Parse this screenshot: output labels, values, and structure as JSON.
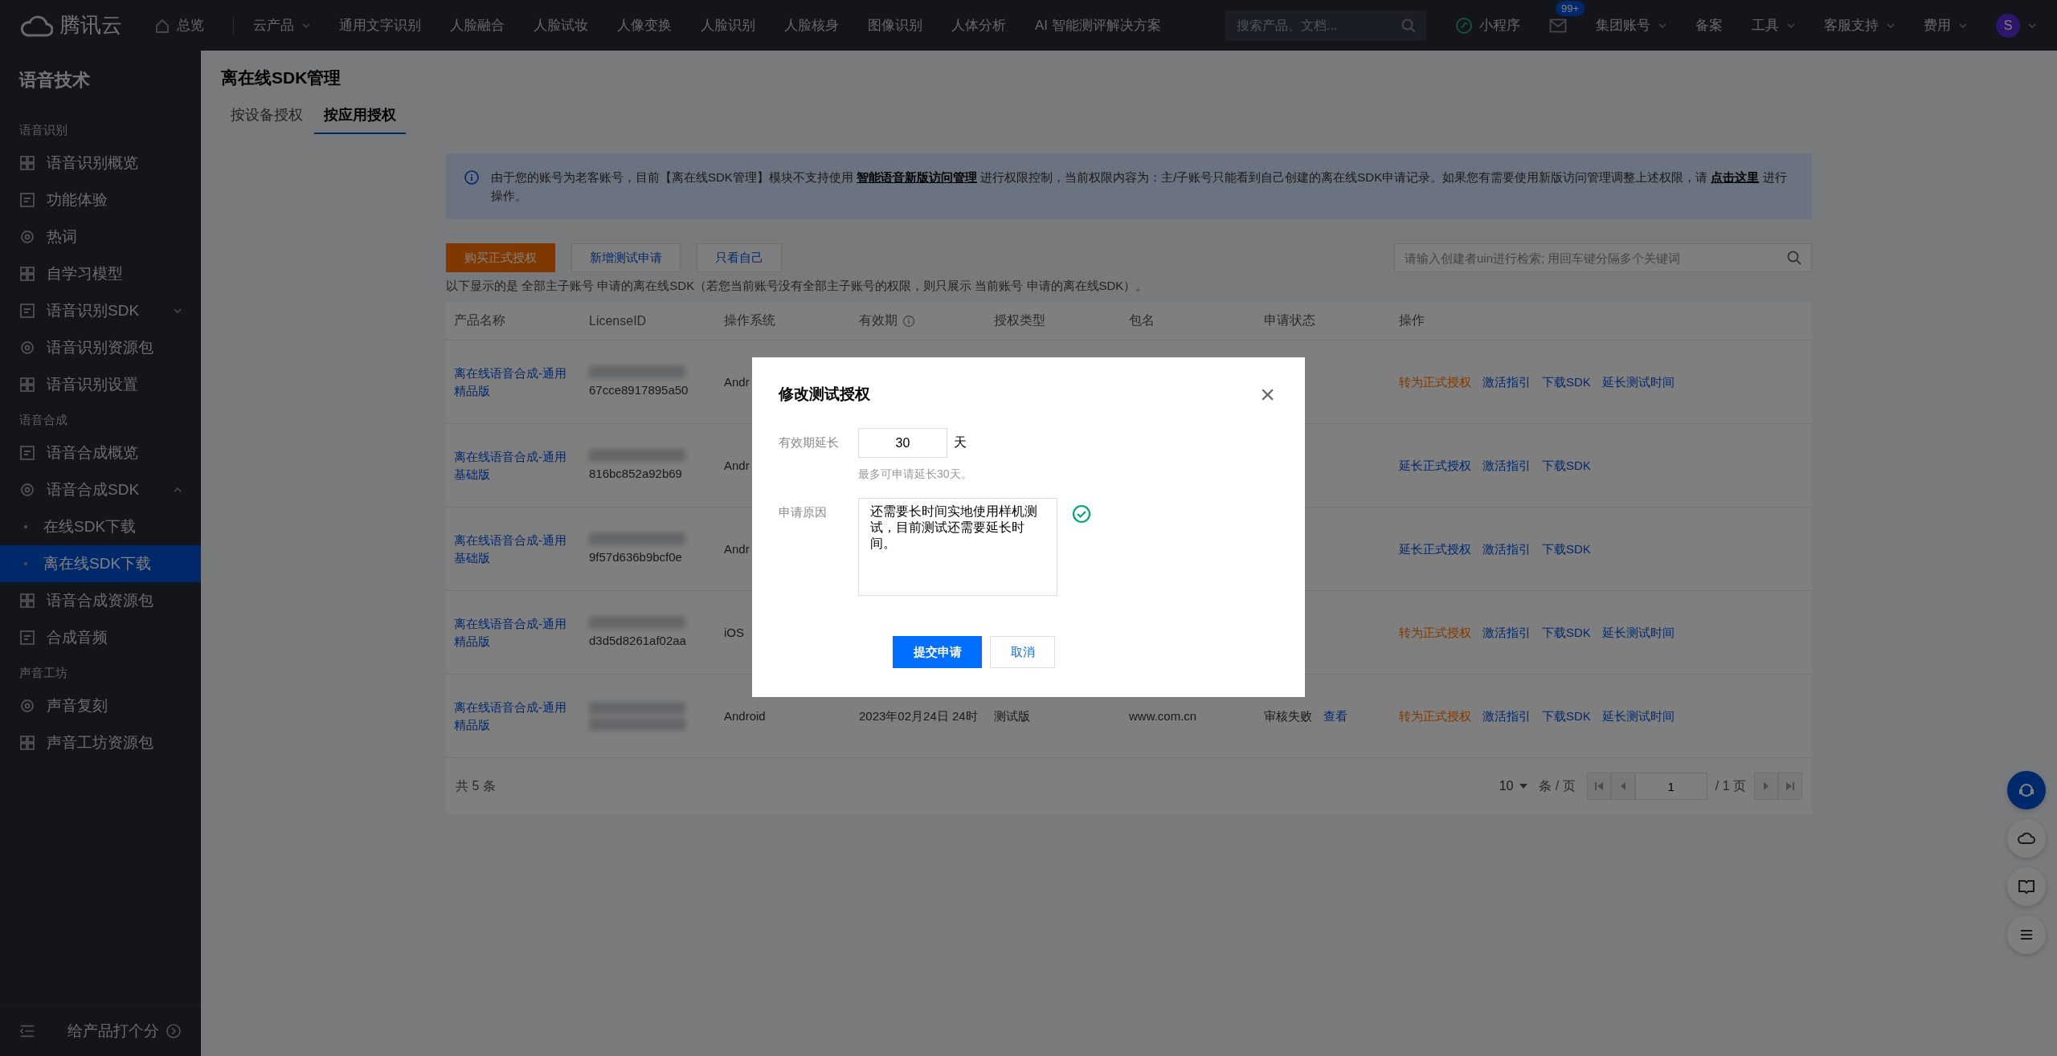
{
  "topbar": {
    "logo": "腾讯云",
    "home": "总览",
    "products": "云产品",
    "nav": [
      "通用文字识别",
      "人脸融合",
      "人脸试妆",
      "人像变换",
      "人脸识别",
      "人脸核身",
      "图像识别",
      "人体分析",
      "AI 智能测评解决方案"
    ],
    "search": {
      "placeholder": "搜索产品、文档..."
    },
    "right": [
      {
        "kind": "mini",
        "label": "小程序"
      },
      {
        "kind": "mail",
        "badge": "99+"
      },
      {
        "kind": "menu",
        "label": "集团账号"
      },
      {
        "kind": "text",
        "label": "备案"
      },
      {
        "kind": "menu",
        "label": "工具"
      },
      {
        "kind": "menu",
        "label": "客服支持"
      },
      {
        "kind": "menu",
        "label": "费用"
      },
      {
        "kind": "avatar",
        "label": "S"
      }
    ]
  },
  "sidebar": {
    "title": "语音技术",
    "groups": [
      {
        "heading": "语音识别",
        "items": [
          {
            "label": "语音识别概览",
            "selected": false
          },
          {
            "label": "功能体验",
            "selected": false
          },
          {
            "label": "热词",
            "selected": false
          },
          {
            "label": "自学习模型",
            "selected": false
          },
          {
            "label": "语音识别SDK",
            "selected": false,
            "expanded": false
          },
          {
            "label": "语音识别资源包",
            "selected": false
          },
          {
            "label": "语音识别设置",
            "selected": false
          }
        ]
      },
      {
        "heading": "语音合成",
        "items": [
          {
            "label": "语音合成概览",
            "selected": false
          },
          {
            "label": "语音合成SDK",
            "selected": false,
            "expanded": true,
            "children": [
              {
                "label": "在线SDK下载",
                "selected": false
              },
              {
                "label": "离在线SDK下载",
                "selected": true
              }
            ]
          },
          {
            "label": "语音合成资源包",
            "selected": false
          },
          {
            "label": "合成音频",
            "selected": false
          }
        ]
      },
      {
        "heading": "声音工坊",
        "items": [
          {
            "label": "声音复刻",
            "selected": false
          },
          {
            "label": "声音工坊资源包",
            "selected": false
          }
        ]
      }
    ],
    "footer": "给产品打个分"
  },
  "page": {
    "title": "离在线SDK管理",
    "tabs": [
      {
        "label": "按设备授权",
        "selected": false
      },
      {
        "label": "按应用授权",
        "selected": true
      }
    ],
    "notice": [
      {
        "kind": "text",
        "text": "由于您的账号为老客账号，目前【离在线SDK管理】模块不支持使用 "
      },
      {
        "kind": "link",
        "text": "智能语音新版访问管理"
      },
      {
        "kind": "text",
        "text": " 进行权限控制，当前权限内容为：主/子账号只能看到自己创建的离在线SDK申请记录。如果您有需要使用新版访问管理调整上述权限，请 "
      },
      {
        "kind": "link",
        "text": "点击这里"
      },
      {
        "kind": "text",
        "text": " 进行操作。"
      }
    ],
    "toolbar": [
      {
        "label": "购买正式授权",
        "kind": "primary"
      },
      {
        "label": "新增测试申请",
        "kind": "default"
      },
      {
        "label": "只看自己",
        "kind": "default"
      }
    ],
    "search": {
      "placeholder": "请输入创建者uin进行检索; 用回车键分隔多个关键词"
    },
    "note": "以下显示的是 全部主子账号 申请的离在线SDK（若您当前账号没有全部主子账号的权限，则只展示 当前账号 申请的离在线SDK）。",
    "table": {
      "columns": [
        {
          "label": "产品名称",
          "info": false
        },
        {
          "label": "LicenseID",
          "info": false
        },
        {
          "label": "操作系统",
          "info": false
        },
        {
          "label": "有效期",
          "info": true
        },
        {
          "label": "授权类型",
          "info": false
        },
        {
          "label": "包名",
          "info": false
        },
        {
          "label": "申请状态",
          "info": false
        },
        {
          "label": "操作",
          "info": false
        }
      ],
      "rows": [
        {
          "product": "离在线语音合成-通用精品版",
          "license_masked": true,
          "license": "67cce8917895a50",
          "os": "Andr",
          "actions": [
            {
              "label": "转为正式授权",
              "kind": "warning"
            },
            {
              "label": "激活指引",
              "kind": "link"
            },
            {
              "label": "下载SDK",
              "kind": "link"
            },
            {
              "label": "延长测试时间",
              "kind": "link"
            }
          ]
        },
        {
          "product": "离在线语音合成-通用基础版",
          "license_masked": true,
          "license": "816bc852a92b69",
          "os": "Andr",
          "actions": [
            {
              "label": "延长正式授权",
              "kind": "link"
            },
            {
              "label": "激活指引",
              "kind": "link"
            },
            {
              "label": "下载SDK",
              "kind": "link"
            }
          ]
        },
        {
          "product": "离在线语音合成-通用基础版",
          "license_masked": true,
          "license": "9f57d636b9bcf0e",
          "os": "Andr",
          "actions": [
            {
              "label": "延长正式授权",
              "kind": "link"
            },
            {
              "label": "激活指引",
              "kind": "link"
            },
            {
              "label": "下载SDK",
              "kind": "link"
            }
          ]
        },
        {
          "product": "离在线语音合成-通用精品版",
          "license_masked": true,
          "license": "d3d5d8261af02aa",
          "os": "iOS",
          "actions": [
            {
              "label": "转为正式授权",
              "kind": "warning"
            },
            {
              "label": "激活指引",
              "kind": "link"
            },
            {
              "label": "下载SDK",
              "kind": "link"
            },
            {
              "label": "延长测试时间",
              "kind": "link"
            }
          ]
        },
        {
          "product": "离在线语音合成-通用精品版",
          "license_masked": true,
          "os": "Android",
          "validity": "2023年02月24日 24时",
          "type": "测试版",
          "package": "www.com.cn",
          "status": "审核失败",
          "status_link": "查看",
          "actions": [
            {
              "label": "转为正式授权",
              "kind": "warning"
            },
            {
              "label": "激活指引",
              "kind": "link"
            },
            {
              "label": "下载SDK",
              "kind": "link"
            },
            {
              "label": "延长测试时间",
              "kind": "link"
            }
          ]
        }
      ],
      "footer": {
        "total": "共 5 条",
        "page_size": "10",
        "per_page": "条 / 页",
        "page": "1",
        "pages": "/ 1 页"
      }
    }
  },
  "modal": {
    "title": "修改测试授权",
    "close": "×",
    "extend": {
      "label": "有效期延长",
      "value": "30",
      "unit": "天",
      "hint": "最多可申请延长30天。"
    },
    "reason": {
      "label": "申请原因",
      "value": "还需要长时间实地使用样机测试，目前测试还需要延长时间。",
      "valid": true
    },
    "buttons": [
      {
        "label": "提交申请",
        "kind": "primary"
      },
      {
        "label": "取消",
        "kind": "default"
      }
    ]
  }
}
